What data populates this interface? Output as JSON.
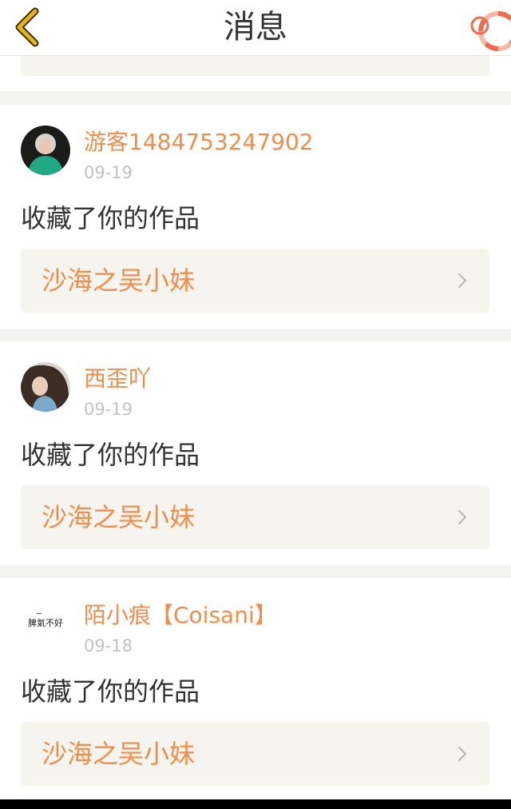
{
  "header": {
    "title": "消息",
    "back_icon": "chevron-left-icon",
    "help_icon": "lifebuoy-icon",
    "accent_color": "#e8b516"
  },
  "colors": {
    "accent": "#ef8e4c",
    "text": "#333333",
    "muted": "#c2c2c2",
    "link_bg": "#f5f4ee",
    "page_bg": "#f3f3f1"
  },
  "messages": [
    {
      "username": "游客1484753247902",
      "date": "09-19",
      "action": "收藏了你的作品",
      "work_title": "沙海之吴小妹"
    },
    {
      "username": "西歪吖",
      "date": "09-19",
      "action": "收藏了你的作品",
      "work_title": "沙海之吴小妹"
    },
    {
      "username": "陌小痕【Coisani】",
      "date": "09-18",
      "action": "收藏了你的作品",
      "work_title": "沙海之吴小妹",
      "avatar_text": "脾氣不好"
    }
  ]
}
